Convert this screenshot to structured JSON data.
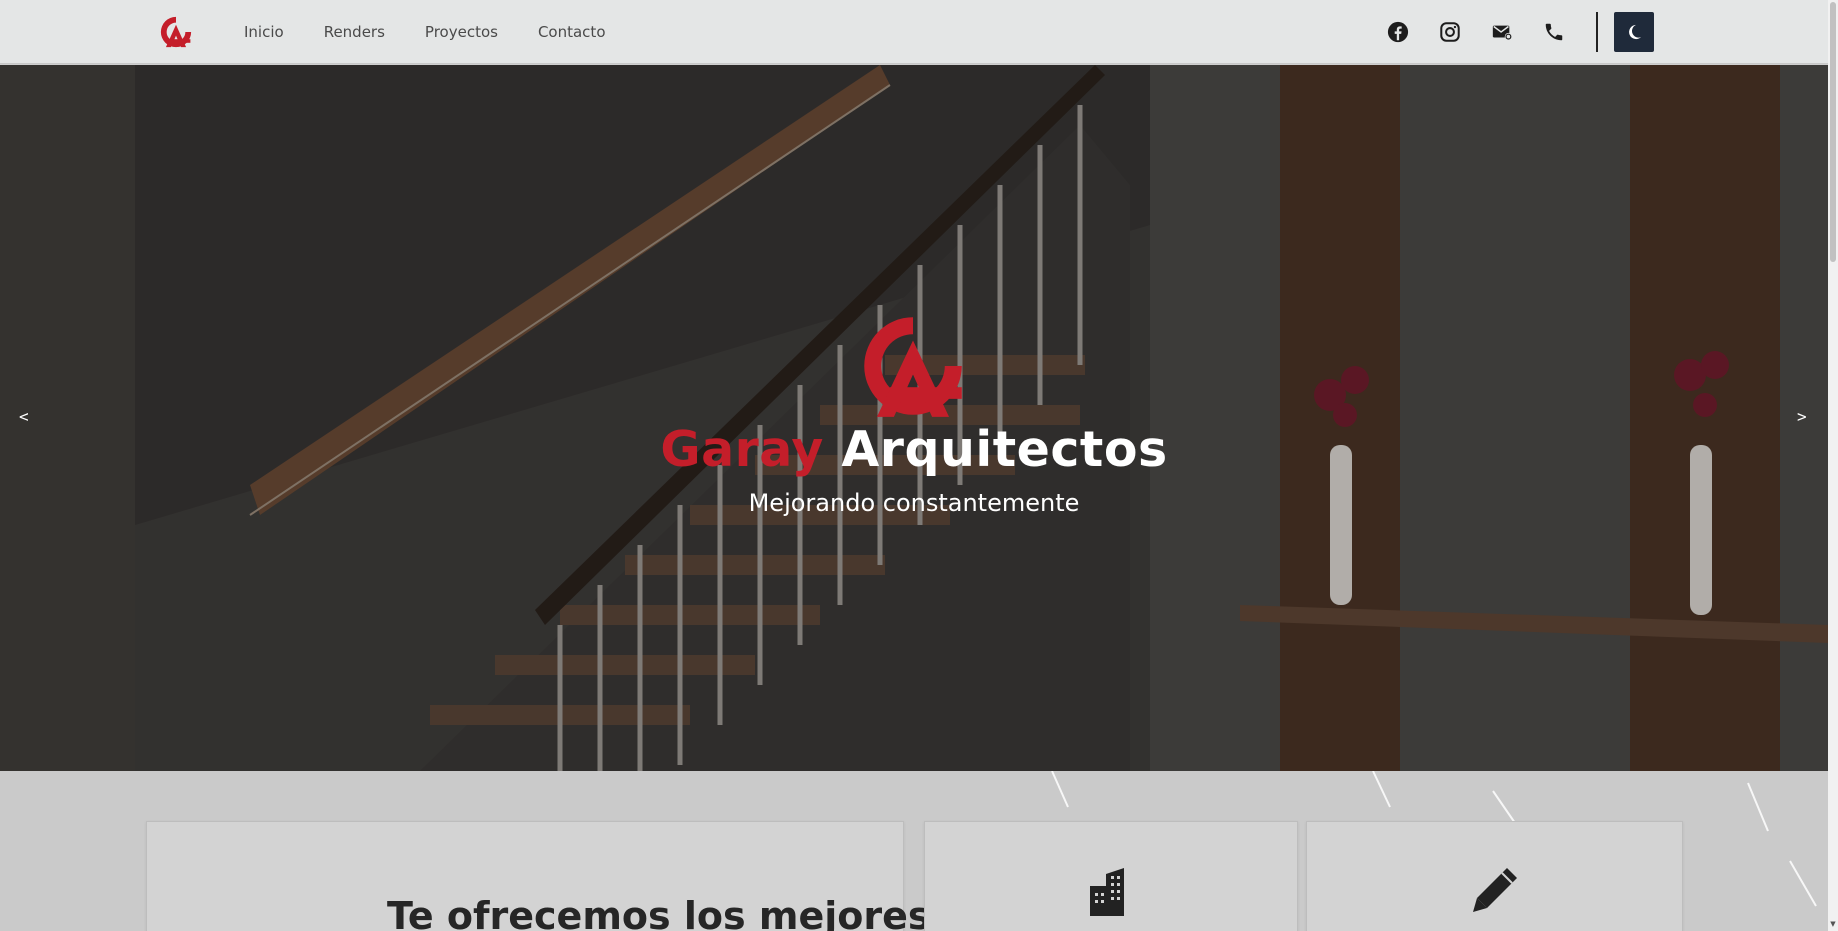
{
  "nav": {
    "logo_alt": "GA",
    "links": [
      "Inicio",
      "Renders",
      "Proyectos",
      "Contacto"
    ],
    "icons": [
      "facebook-icon",
      "instagram-icon",
      "mail-icon",
      "phone-icon"
    ],
    "theme_toggle_icon": "moon-icon"
  },
  "hero": {
    "title_red": "Garay",
    "title_white": "Arquitectos",
    "subtitle": "Mejorando constantemente",
    "prev_arrow": "<",
    "next_arrow": ">"
  },
  "section": {
    "card_heading": "Te ofrecemos los mejores",
    "card2_icon": "building-icon",
    "card3_icon": "pencil-icon"
  },
  "colors": {
    "brand_red": "#c41e2a",
    "nav_bg": "#e4e6e6",
    "toggle_bg": "#1f2a3a"
  }
}
